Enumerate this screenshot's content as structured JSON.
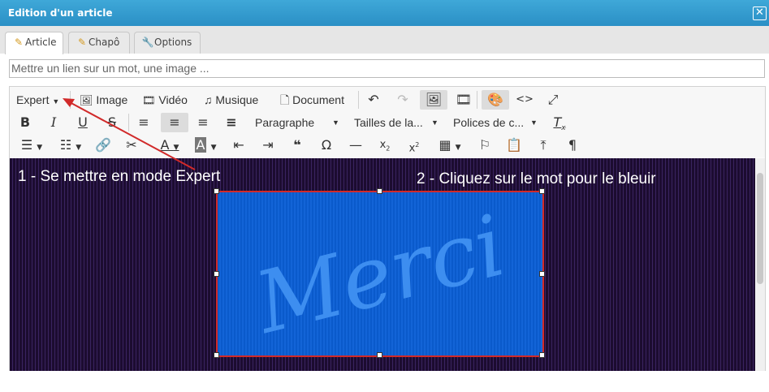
{
  "window": {
    "title": "Edition d'un article",
    "close_glyph": "✕"
  },
  "tabs": [
    {
      "label": "Article",
      "icon": "pencil-icon",
      "active": true
    },
    {
      "label": "Chapô",
      "icon": "pencil-icon",
      "active": false
    },
    {
      "label": "Options",
      "icon": "wrench-icon",
      "active": false
    }
  ],
  "link_field": {
    "value": "Mettre un lien sur un mot, une image ..."
  },
  "toolbar": {
    "mode_label": "Expert",
    "image_label": "Image",
    "video_label": "Vidéo",
    "music_label": "Musique",
    "document_label": "Document",
    "paragraph_label": "Paragraphe",
    "font_size_label": "Tailles de la...",
    "font_family_label": "Polices de c..."
  },
  "content": {
    "caption_left": "1 - Se mettre en mode Expert",
    "caption_right": "2 - Cliquez sur le mot pour le bleuir",
    "image_text": "Merci"
  },
  "colors": {
    "titlebar": "#2a8fc5",
    "annotation_arrow": "#d12a2a",
    "content_background": "#1e0e33",
    "image_background": "#0b5fd6",
    "image_text": "#3d8ef0"
  }
}
